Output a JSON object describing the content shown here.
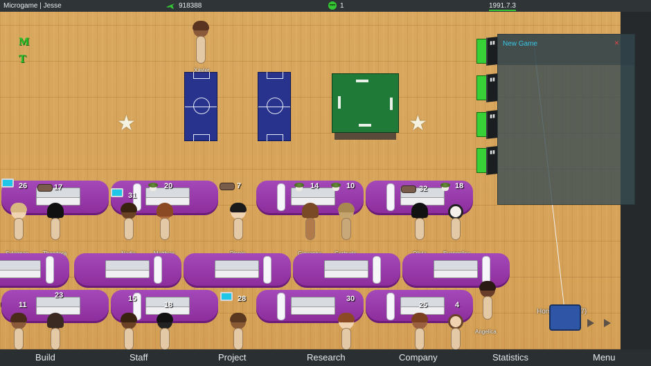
{
  "topbar": {
    "company": "Microgame | Jesse",
    "money_icon": "plane-icon",
    "money": "918388",
    "fans_icon": "green-face-icon",
    "fans": "1",
    "date": "1991.7.3"
  },
  "floor_markers": {
    "m": "M",
    "t": "T"
  },
  "panel": {
    "title": "New Game",
    "close": "×"
  },
  "home": {
    "label": "Home (416/417)"
  },
  "colors": {
    "accent_cyan": "#39c6e6",
    "desk_purple": "#9b3aaa",
    "floor_wood": "#d6a35a",
    "server_green": "#37d037",
    "close_red": "#e04444"
  },
  "people_names": {
    "xavier": "Xavier",
    "suleiman": "Suleiman",
    "theodora": "Theodora",
    "nadia": "Nadia",
    "matthias": "Matthias",
    "pippin": "Pippin",
    "giovanna": "Giovanna",
    "gertrude": "Gertrude",
    "olivia": "Olivia",
    "evangeline": "Evangeline",
    "angelica": "Angelica"
  },
  "desk_numbers": {
    "n26": "26",
    "n17": "17",
    "n31": "31",
    "n20": "20",
    "n7": "7",
    "n14": "14",
    "n10": "10",
    "n32": "32",
    "n18a": "18",
    "n11": "11",
    "n23": "23",
    "n15": "15",
    "n18b": "18",
    "n28": "28",
    "n30": "30",
    "n25": "25",
    "n4": "4"
  },
  "bottom_menu": {
    "build": "Build",
    "staff": "Staff",
    "project": "Project",
    "research": "Research",
    "company": "Company",
    "statistics": "Statistics",
    "menu": "Menu"
  }
}
